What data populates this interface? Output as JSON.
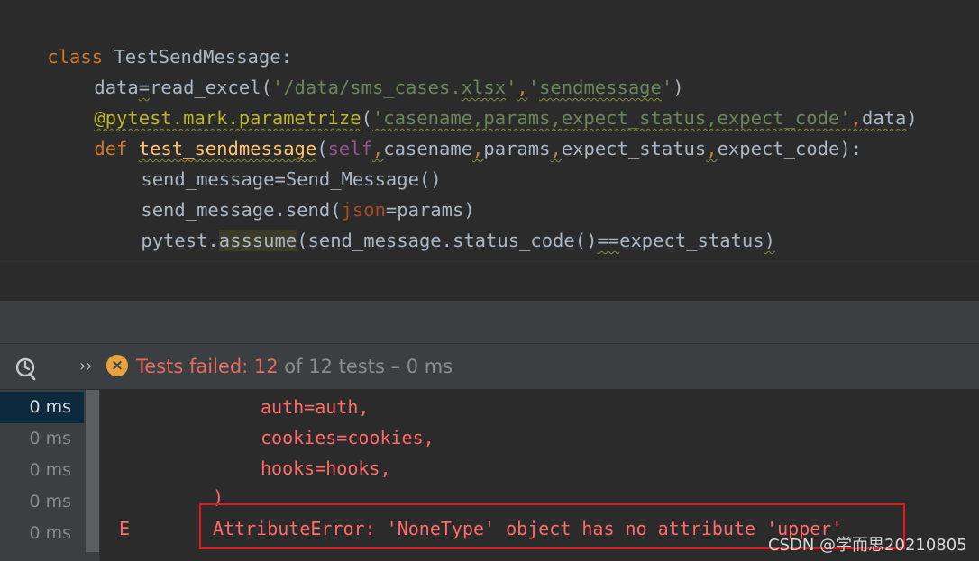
{
  "editor": {
    "lines": [
      {
        "tokens": [
          "class",
          " ",
          "TestSendMessage",
          ":"
        ]
      },
      {
        "tokens": [
          "data",
          "=",
          "read_excel",
          "(",
          "'/data/sms_cases.",
          "xlsx",
          "'",
          ",",
          "'",
          "sendmessage",
          "'",
          ")"
        ]
      },
      {
        "tokens": [
          "@pytest.mark.parametrize",
          "(",
          "'casename,params,expect_status,expect_code'",
          ",",
          "data",
          ")"
        ]
      },
      {
        "tokens": [
          "def",
          " ",
          "test_sendmessage",
          "(",
          "self",
          ",",
          "casename",
          ",",
          "params",
          ",",
          "expect_status",
          ",",
          "expect_code",
          "):"
        ]
      },
      {
        "tokens": [
          "send_message",
          "=",
          "Send_Message",
          "()"
        ]
      },
      {
        "tokens": [
          "send_message.send",
          "(",
          "json",
          "=",
          "params",
          ")"
        ]
      },
      {
        "tokens": [
          "pytest.",
          "asssume",
          "(",
          "send_message.status_code",
          "()",
          "==",
          "expect_status",
          ")"
        ]
      }
    ]
  },
  "run_toolbar": {
    "chevron": "››",
    "status_fail_label": "Tests failed: 12",
    "status_rest": " of 12 tests – 0 ms"
  },
  "test_tree": {
    "rows": [
      "0 ms",
      "0 ms",
      "0 ms",
      "0 ms",
      "0 ms"
    ]
  },
  "console": {
    "lines": [
      "auth=auth,",
      "cookies=cookies,",
      "hooks=hooks,",
      ")"
    ],
    "error_marker": "E",
    "error_message": "AttributeError: 'NoneType' object has no attribute 'upper'"
  },
  "watermark": "CSDN @学而思20210805",
  "colors": {
    "editor_bg": "#2b2b2b",
    "panel_bg": "#3c3f41",
    "error_red": "#ff6b68",
    "highlight_box": "#e3191e",
    "fail_icon": "#e8a33d"
  }
}
